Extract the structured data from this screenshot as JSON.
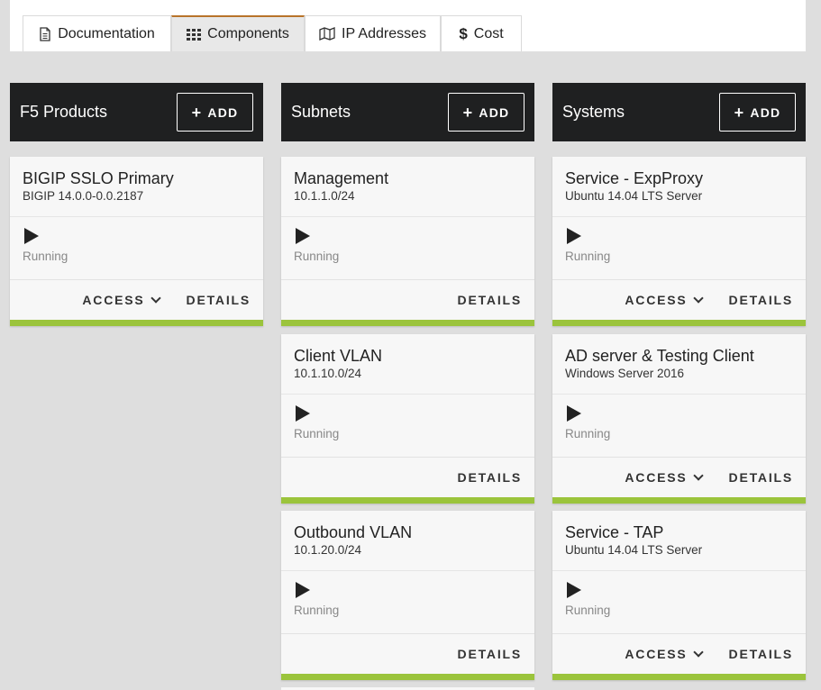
{
  "tabs": [
    {
      "label": "Documentation",
      "icon": "document-icon"
    },
    {
      "label": "Components",
      "icon": "grid-icon",
      "active": true
    },
    {
      "label": "IP Addresses",
      "icon": "map-icon"
    },
    {
      "label": "Cost",
      "icon": "dollar-icon"
    }
  ],
  "columns": [
    {
      "title": "F5 Products",
      "add_label": "ADD",
      "cards": [
        {
          "name": "BIGIP SSLO Primary",
          "sub": "BIGIP 14.0.0-0.0.2187",
          "status": "Running",
          "access": "ACCESS",
          "details": "DETAILS"
        }
      ]
    },
    {
      "title": "Subnets",
      "add_label": "ADD",
      "cards": [
        {
          "name": "Management",
          "sub": "10.1.1.0/24",
          "status": "Running",
          "details": "DETAILS"
        },
        {
          "name": "Client VLAN",
          "sub": "10.1.10.0/24",
          "status": "Running",
          "details": "DETAILS"
        },
        {
          "name": "Outbound VLAN",
          "sub": "10.1.20.0/24",
          "status": "Running",
          "details": "DETAILS"
        }
      ]
    },
    {
      "title": "Systems",
      "add_label": "ADD",
      "cards": [
        {
          "name": "Service - ExpProxy",
          "sub": "Ubuntu 14.04 LTS Server",
          "status": "Running",
          "access": "ACCESS",
          "details": "DETAILS"
        },
        {
          "name": "AD server & Testing Client",
          "sub": "Windows Server 2016",
          "status": "Running",
          "access": "ACCESS",
          "details": "DETAILS"
        },
        {
          "name": "Service - TAP",
          "sub": "Ubuntu 14.04 LTS Server",
          "status": "Running",
          "access": "ACCESS",
          "details": "DETAILS"
        }
      ]
    }
  ],
  "colors": {
    "accent_bar": "#9bc43c",
    "header_bg": "#1f2021",
    "active_tab_border": "#b8732a"
  }
}
